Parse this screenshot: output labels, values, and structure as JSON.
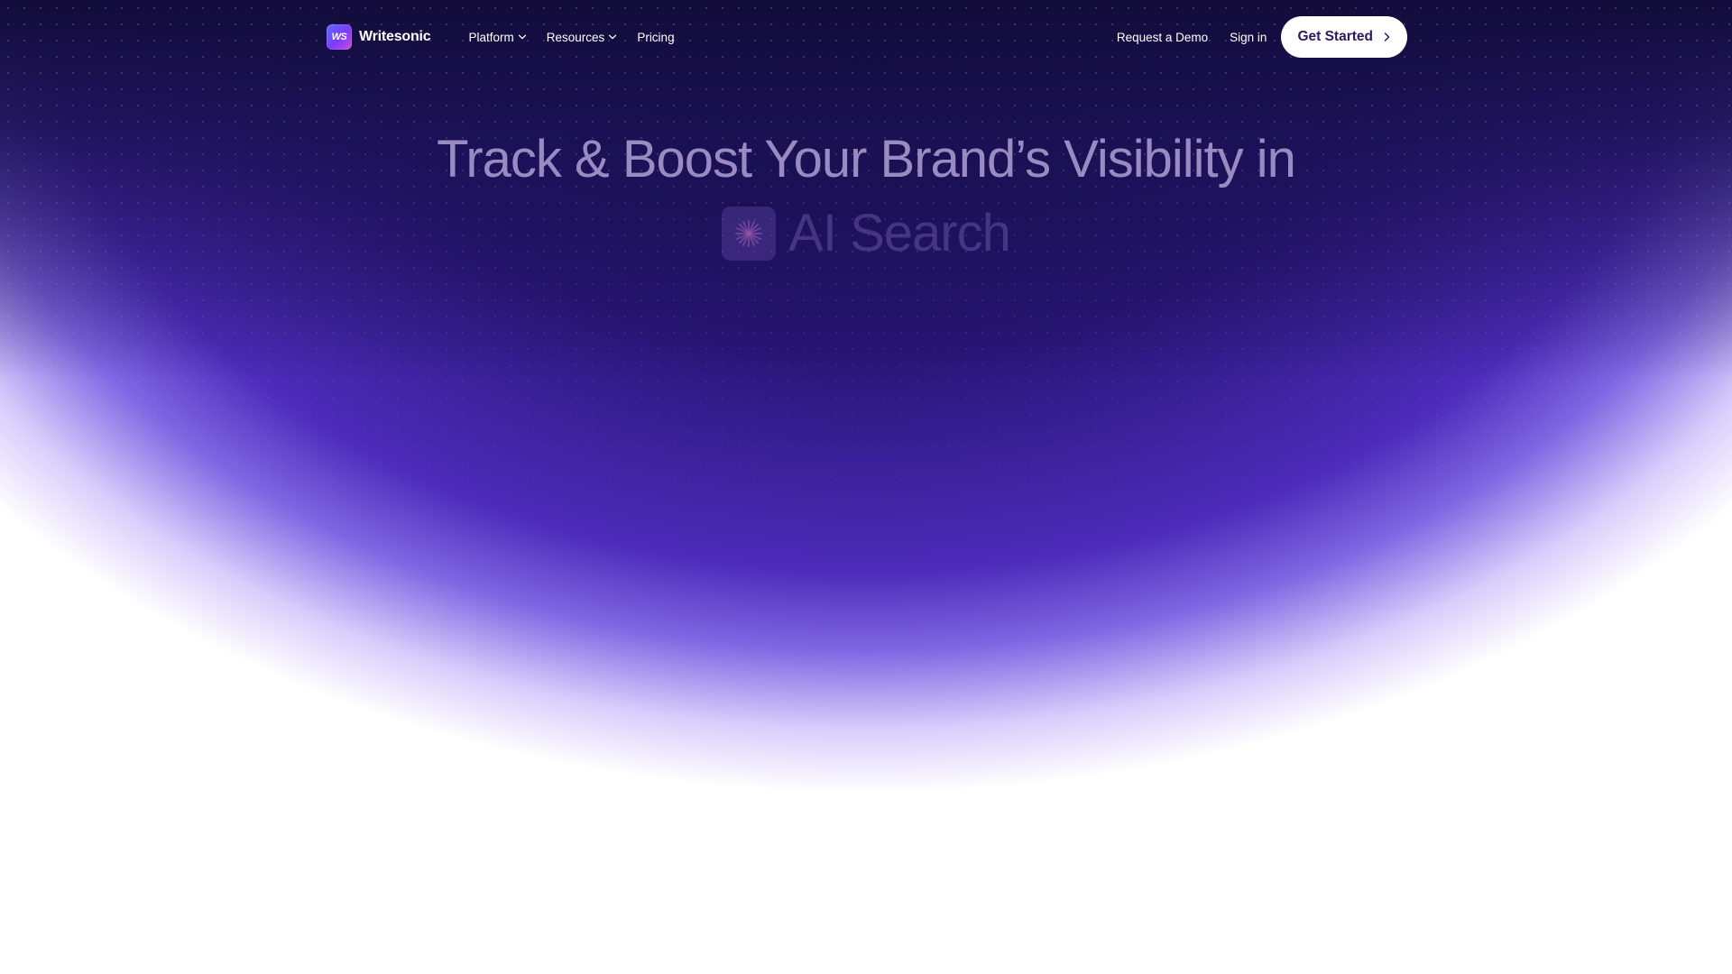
{
  "brand": {
    "logo_mark": "WS",
    "name": "Writesonic"
  },
  "nav": {
    "items": [
      {
        "label": "Platform",
        "has_dropdown": true,
        "icon": "chevron-down-icon"
      },
      {
        "label": "Resources",
        "has_dropdown": true,
        "icon": "chevron-down-icon"
      },
      {
        "label": "Pricing",
        "has_dropdown": false
      }
    ],
    "request_demo": "Request a Demo",
    "sign_in": "Sign in",
    "get_started": "Get Started",
    "get_started_icon": "chevron-right-icon"
  },
  "hero": {
    "headline_line1": "Track & Boost Your Brand’s Visibility in",
    "headline_line2": "AI Search",
    "badge_icon": "ai-sparkle-icon"
  },
  "colors": {
    "background_top": "#160e46",
    "background_glow": "#4c2cba",
    "cta_background": "#ffffff",
    "cta_text": "#2a1a66",
    "logo_gradient_start": "#5a6cff",
    "logo_gradient_end": "#d04bd6"
  }
}
